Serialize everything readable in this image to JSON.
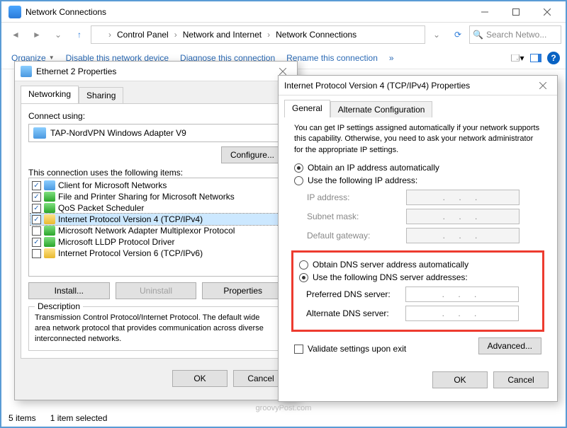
{
  "window": {
    "title": "Network Connections"
  },
  "breadcrumb": {
    "root": "Control Panel",
    "mid": "Network and Internet",
    "leaf": "Network Connections"
  },
  "search": {
    "placeholder": "Search Netwo..."
  },
  "toolbar": {
    "organize": "Organize",
    "disable": "Disable this network device",
    "diagnose": "Diagnose this connection",
    "rename": "Rename this connection",
    "more": "»"
  },
  "status": {
    "items": "5 items",
    "selected": "1 item selected"
  },
  "eth": {
    "title": "Ethernet 2 Properties",
    "tabs": {
      "networking": "Networking",
      "sharing": "Sharing"
    },
    "connect_using": "Connect using:",
    "adapter": "TAP-NordVPN Windows Adapter V9",
    "configure": "Configure...",
    "uses_label": "This connection uses the following items:",
    "items": [
      "Client for Microsoft Networks",
      "File and Printer Sharing for Microsoft Networks",
      "QoS Packet Scheduler",
      "Internet Protocol Version 4 (TCP/IPv4)",
      "Microsoft Network Adapter Multiplexor Protocol",
      "Microsoft LLDP Protocol Driver",
      "Internet Protocol Version 6 (TCP/IPv6)"
    ],
    "install": "Install...",
    "uninstall": "Uninstall",
    "properties": "Properties",
    "desc_label": "Description",
    "desc": "Transmission Control Protocol/Internet Protocol. The default wide area network protocol that provides communication across diverse interconnected networks.",
    "ok": "OK",
    "cancel": "Cancel"
  },
  "ip": {
    "title": "Internet Protocol Version 4 (TCP/IPv4) Properties",
    "tabs": {
      "general": "General",
      "alt": "Alternate Configuration"
    },
    "info": "You can get IP settings assigned automatically if your network supports this capability. Otherwise, you need to ask your network administrator for the appropriate IP settings.",
    "obtain_ip": "Obtain an IP address automatically",
    "use_ip": "Use the following IP address:",
    "ip_addr": "IP address:",
    "subnet": "Subnet mask:",
    "gateway": "Default gateway:",
    "obtain_dns": "Obtain DNS server address automatically",
    "use_dns": "Use the following DNS server addresses:",
    "pref_dns": "Preferred DNS server:",
    "alt_dns": "Alternate DNS server:",
    "validate": "Validate settings upon exit",
    "advanced": "Advanced...",
    "ok": "OK",
    "cancel": "Cancel"
  },
  "watermark": "groovyPost.com",
  "help": "?"
}
